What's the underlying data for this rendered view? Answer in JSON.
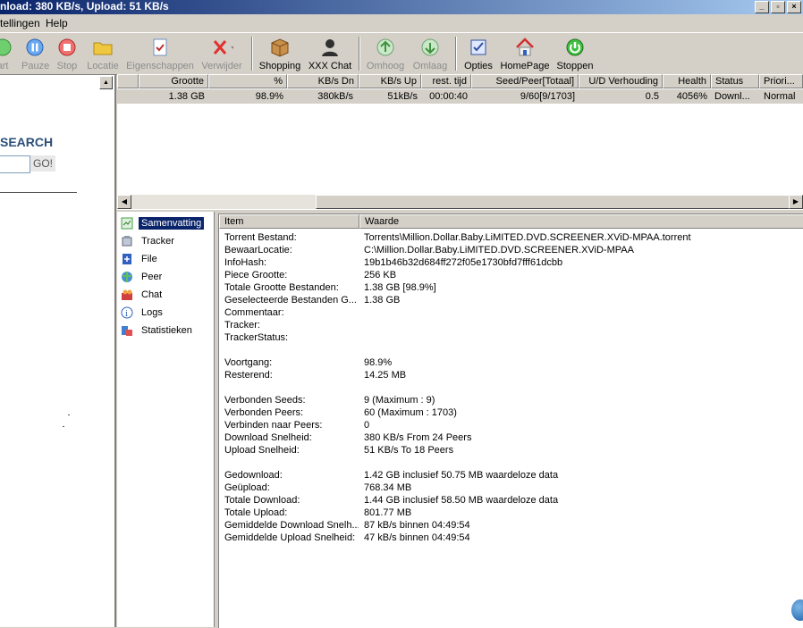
{
  "window": {
    "title": "nload: 380 KB/s, Upload: 51 KB/s",
    "buttons": [
      "_",
      "▫",
      "×"
    ]
  },
  "menu": [
    "tellingen",
    "Help"
  ],
  "toolbar": [
    {
      "label": "art",
      "icon": "start-icon",
      "disabled": true
    },
    {
      "label": "Pauze",
      "icon": "pause-icon",
      "disabled": true
    },
    {
      "label": "Stop",
      "icon": "stop-icon",
      "disabled": true
    },
    {
      "label": "Locatie",
      "icon": "folder-icon",
      "disabled": true
    },
    {
      "label": "Eigenschappen",
      "icon": "properties-icon",
      "disabled": true
    },
    {
      "label": "Verwijder",
      "icon": "delete-icon",
      "disabled": true
    },
    {
      "label": "Shopping",
      "icon": "box-icon",
      "disabled": false
    },
    {
      "label": "XXX Chat",
      "icon": "chat-user-icon",
      "disabled": false
    },
    {
      "label": "Omhoog",
      "icon": "arrow-up-icon",
      "disabled": true
    },
    {
      "label": "Omlaag",
      "icon": "arrow-down-icon",
      "disabled": true
    },
    {
      "label": "Opties",
      "icon": "options-icon",
      "disabled": false
    },
    {
      "label": "HomePage",
      "icon": "home-icon",
      "disabled": false
    },
    {
      "label": "Stoppen",
      "icon": "power-icon",
      "disabled": false
    }
  ],
  "search": {
    "title": "SEARCH",
    "button": "GO!",
    "input_value": ""
  },
  "torrent_list": {
    "headers": [
      "Grootte",
      "%",
      "KB/s Dn",
      "KB/s Up",
      "rest. tijd",
      "Seed/Peer[Totaal]",
      "U/D Verhouding",
      "Health",
      "Status",
      "Priori..."
    ],
    "row": [
      "1.38 GB",
      "98.9%",
      "380kB/s",
      "51kB/s",
      "00:00:40",
      "9/60[9/1703]",
      "0.5",
      "4056%",
      "Downl...",
      "Normal"
    ]
  },
  "nav": [
    {
      "label": "Samenvatting",
      "icon": "summary-icon",
      "selected": true
    },
    {
      "label": "Tracker",
      "icon": "tracker-icon",
      "selected": false
    },
    {
      "label": "File",
      "icon": "file-icon",
      "selected": false
    },
    {
      "label": "Peer",
      "icon": "peer-icon",
      "selected": false
    },
    {
      "label": "Chat",
      "icon": "chat-icon",
      "selected": false
    },
    {
      "label": "Logs",
      "icon": "logs-icon",
      "selected": false
    },
    {
      "label": "Statistieken",
      "icon": "stats-icon",
      "selected": false
    }
  ],
  "details": {
    "headers": [
      "Item",
      "Waarde"
    ],
    "rows": [
      {
        "k": "Torrent Bestand:",
        "v": "Torrents\\Million.Dollar.Baby.LiMITED.DVD.SCREENER.XViD-MPAA.torrent"
      },
      {
        "k": "BewaarLocatie:",
        "v": "C:\\Million.Dollar.Baby.LiMITED.DVD.SCREENER.XViD-MPAA"
      },
      {
        "k": "InfoHash:",
        "v": "19b1b46b32d684ff272f05e1730bfd7fff61dcbb"
      },
      {
        "k": "Piece Grootte:",
        "v": "256 KB"
      },
      {
        "k": "Totale Grootte Bestanden:",
        "v": "1.38 GB [98.9%]"
      },
      {
        "k": "Geselecteerde Bestanden G...",
        "v": "1.38 GB"
      },
      {
        "k": "Commentaar:",
        "v": ""
      },
      {
        "k": "Tracker:",
        "v": ""
      },
      {
        "k": "TrackerStatus:",
        "v": ""
      },
      {
        "k": "",
        "v": ""
      },
      {
        "k": "Voortgang:",
        "v": "98.9%"
      },
      {
        "k": "Resterend:",
        "v": "14.25 MB"
      },
      {
        "k": "",
        "v": ""
      },
      {
        "k": "Verbonden Seeds:",
        "v": "9 (Maximum : 9)"
      },
      {
        "k": "Verbonden Peers:",
        "v": "60 (Maximum : 1703)"
      },
      {
        "k": "Verbinden naar Peers:",
        "v": "0"
      },
      {
        "k": "Download Snelheid:",
        "v": "380 KB/s From 24 Peers"
      },
      {
        "k": "Upload Snelheid:",
        "v": "51 KB/s To 18 Peers"
      },
      {
        "k": "",
        "v": ""
      },
      {
        "k": "Gedownload:",
        "v": "1.42 GB inclusief 50.75 MB waardeloze data"
      },
      {
        "k": "Geüpload:",
        "v": "768.34 MB"
      },
      {
        "k": "Totale Download:",
        "v": "1.44 GB inclusief 58.50 MB waardeloze data"
      },
      {
        "k": "Totale Upload:",
        "v": "801.77 MB"
      },
      {
        "k": "Gemiddelde Download Snelh...",
        "v": "87 kB/s binnen 04:49:54"
      },
      {
        "k": "Gemiddelde Upload Snelheid:",
        "v": "47 kB/s binnen 04:49:54"
      }
    ]
  }
}
